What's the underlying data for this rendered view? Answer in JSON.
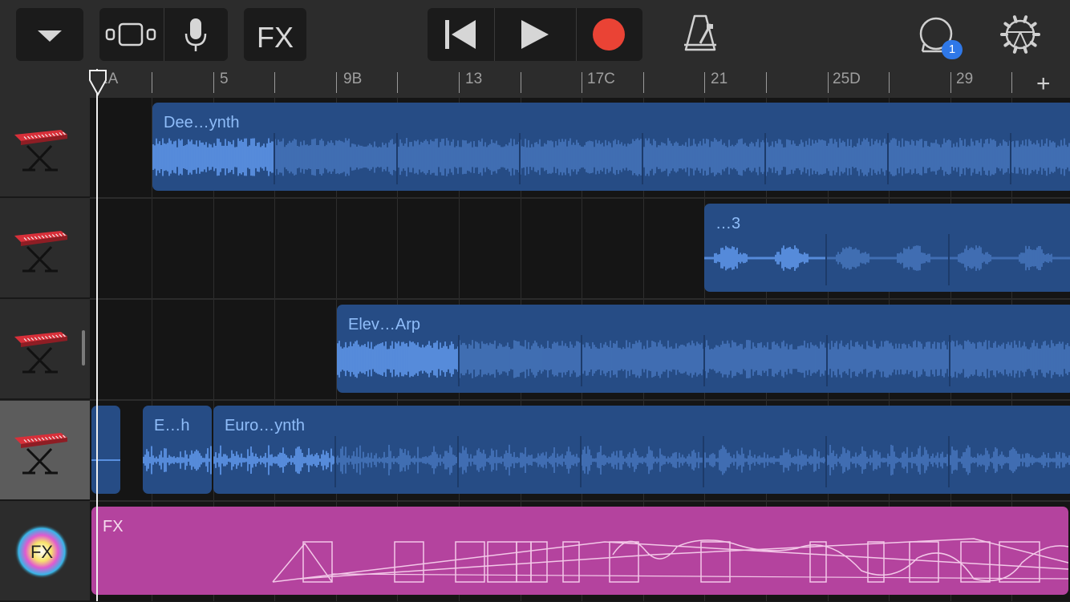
{
  "toolbar": {
    "fx_label": "FX",
    "loop_badge": "1",
    "icons": [
      "tracks-menu-icon",
      "view-toggle-icon",
      "microphone-icon",
      "rewind-icon",
      "play-icon",
      "record-icon",
      "metronome-icon",
      "loop-icon",
      "settings-icon"
    ],
    "record_color": "#ea4335"
  },
  "ruler": {
    "labels": [
      "1A",
      "5",
      "9B",
      "13",
      "17C",
      "21",
      "25D",
      "29"
    ],
    "add_label": "+"
  },
  "tracks": [
    {
      "instrument": "keyboard-icon",
      "regions": [
        {
          "name": "Dee…ynth"
        }
      ]
    },
    {
      "instrument": "keyboard-icon",
      "regions": [
        {
          "name": "…3"
        }
      ]
    },
    {
      "instrument": "keyboard-icon",
      "regions": [
        {
          "name": "Elev…Arp"
        }
      ]
    },
    {
      "instrument": "keyboard-icon",
      "selected": true,
      "regions": [
        {
          "name": ""
        },
        {
          "name": "E…h"
        },
        {
          "name": "Euro…ynth"
        }
      ]
    },
    {
      "instrument": "fx-icon",
      "icon_text": "FX",
      "regions": [
        {
          "name": "FX"
        }
      ]
    }
  ],
  "colors": {
    "region": "#264c85",
    "region_label": "#8fbdf9",
    "fx_region": "#b4439e",
    "waveform_active": "#6aa6ff",
    "waveform": "#4b7cc5"
  }
}
